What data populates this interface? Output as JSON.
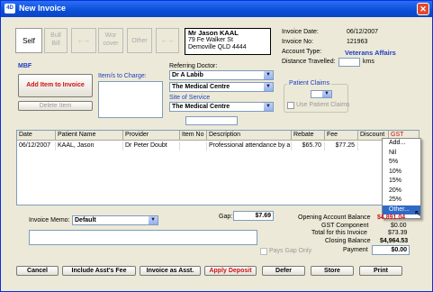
{
  "window": {
    "title": "New Invoice",
    "app_icon": "4D"
  },
  "tabs": [
    {
      "label": "Self"
    },
    {
      "label": "Bull\nBill"
    },
    {
      "label": "←→"
    },
    {
      "label": "Wor\ncover"
    },
    {
      "label": "Other"
    },
    {
      "label": "←→"
    }
  ],
  "patient": {
    "name": "Mr Jason KAAL",
    "address1": "79 Fe Walker St",
    "address2": "Demoville QLD 4444"
  },
  "invoice_info": {
    "date_label": "Invoice Date:",
    "date": "06/12/2007",
    "no_label": "Invoice No:",
    "no": "121963",
    "account_label": "Account Type:",
    "account": "Veterans Affairs",
    "distance_label": "Distance Travelled:",
    "distance_unit": "kms"
  },
  "left": {
    "mbf": "MBF",
    "add_item": "Add Item to Invoice",
    "delete_item": "Delete Item"
  },
  "items_to_charge_label": "Item/s to Charge:",
  "referring": {
    "label": "Referring Doctor:",
    "doctor": "Dr A Labib",
    "centre": "The Medical Centre",
    "site_label": "Site of Service",
    "site": "The Medical Centre"
  },
  "patient_claims": {
    "label": "Patient Claims",
    "use_label": "Use Patient Claims"
  },
  "table": {
    "headers": [
      "Date",
      "Patient Name",
      "Provider",
      "Item No",
      "Description",
      "Rebate",
      "Fee",
      "Discount",
      "GST"
    ],
    "row": [
      "06/12/2007",
      "KAAL, Jason",
      "Dr Peter Doubt",
      "",
      "Professional attendance by a s",
      "$65.70",
      "$77.25",
      "",
      ""
    ]
  },
  "gst_menu": {
    "items": [
      "Add...",
      "Nil",
      "5%",
      "10%",
      "15%",
      "20%",
      "25%",
      "Other..."
    ],
    "selected": 7
  },
  "memo": {
    "label": "Invoice Memo:",
    "value": "Default"
  },
  "gap": {
    "label": "Gap:",
    "value": "$7.69"
  },
  "totals": {
    "opening_label": "Opening Account Balance",
    "opening": "$4,891.04",
    "gst_label": "GST Component",
    "gst": "$0.00",
    "total_label": "Total for this Invoice",
    "total": "$73.39",
    "closing_label": "Closing Balance",
    "closing": "$4,964.53",
    "payment_label": "Payment",
    "payment": "$0.00"
  },
  "pays_gap_label": "Pays Gap Only",
  "buttons": {
    "cancel": "Cancel",
    "include": "Include Asst's Fee",
    "invoice_asst": "Invoice as Asst.",
    "apply_deposit": "Apply Deposit",
    "defer": "Defer",
    "store": "Store",
    "print": "Print"
  },
  "colors": {
    "accent": "#0a4ed8",
    "link_blue": "#2040c0",
    "danger": "#d01010"
  }
}
